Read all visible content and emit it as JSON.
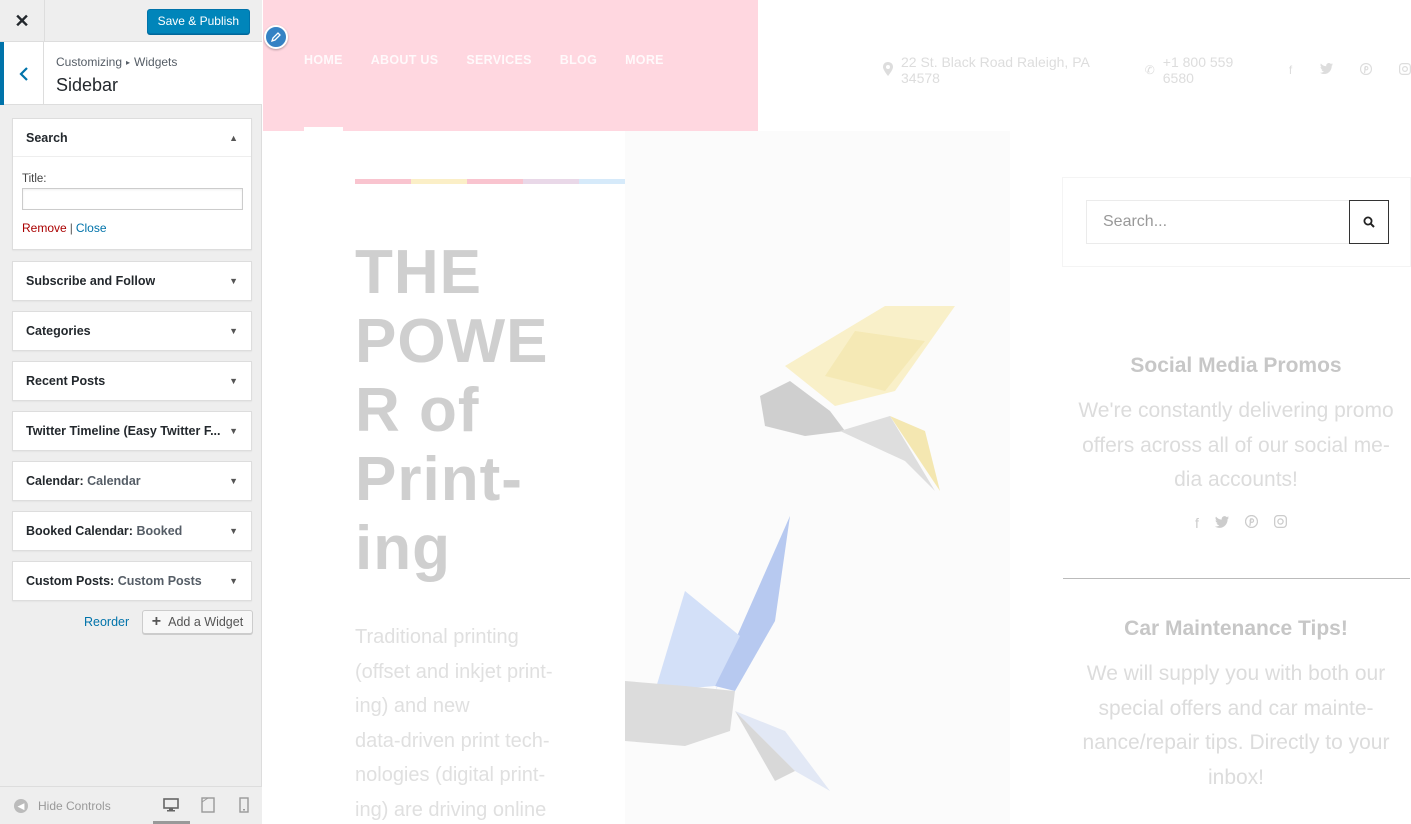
{
  "customizer": {
    "close_icon": "close-icon",
    "publish_label": "Save & Publish",
    "breadcrumb": {
      "root": "Customizing",
      "child": "Widgets"
    },
    "section_title": "Sidebar",
    "search_widget": {
      "title": "Search",
      "field_label": "Title:",
      "field_value": "",
      "remove_label": "Remove",
      "separator": "|",
      "close_label": "Close"
    },
    "widgets": [
      {
        "name": "Subscribe and Follow",
        "sub": ""
      },
      {
        "name": "Categories",
        "sub": ""
      },
      {
        "name": "Recent Posts",
        "sub": ""
      },
      {
        "name": "Twitter Timeline (Easy Twitter F...",
        "sub": ""
      },
      {
        "name": "Calendar:",
        "sub": "Calendar"
      },
      {
        "name": "Booked Calendar:",
        "sub": "Booked"
      },
      {
        "name": "Custom Posts:",
        "sub": "Custom Posts"
      }
    ],
    "reorder_label": "Reorder",
    "add_widget_label": "Add a Widget",
    "hide_controls_label": "Hide Controls",
    "accent_color": "#0073aa",
    "publish_color": "#0085ba",
    "remove_color": "#aa0000"
  },
  "preview": {
    "nav": [
      "HOME",
      "ABOUT US",
      "SERVICES",
      "BLOG",
      "MORE"
    ],
    "address": "22 St. Black Road Raleigh, PA 34578",
    "phone": "+1 800 559 6580",
    "hero_title": [
      "THE",
      "POWE",
      "R of",
      "Print-",
      "ing"
    ],
    "hero_text": [
      "Traditional printing",
      "(offset and inkjet print-",
      "ing) and new",
      "data-driven print tech-",
      "nologies (digital print-",
      "ing) are driving online"
    ],
    "search_placeholder": "Search...",
    "promo1": {
      "title": "Social Media Promos",
      "text": [
        "We're constantly delivering promo",
        "offers across all of our social me-",
        "dia accounts!"
      ]
    },
    "promo2": {
      "title": "Car Maintenance Tips!",
      "text": [
        "We will supply you with both our",
        "special offers and car mainte-",
        "nance/repair tips. Directly to your",
        "inbox!"
      ]
    },
    "colorbar": [
      "#f9c4cf",
      "#fbefc7",
      "#f9c4cf",
      "#e9d8e8",
      "#d6eafa"
    ],
    "nav_band_color": "#ffd7e0"
  }
}
